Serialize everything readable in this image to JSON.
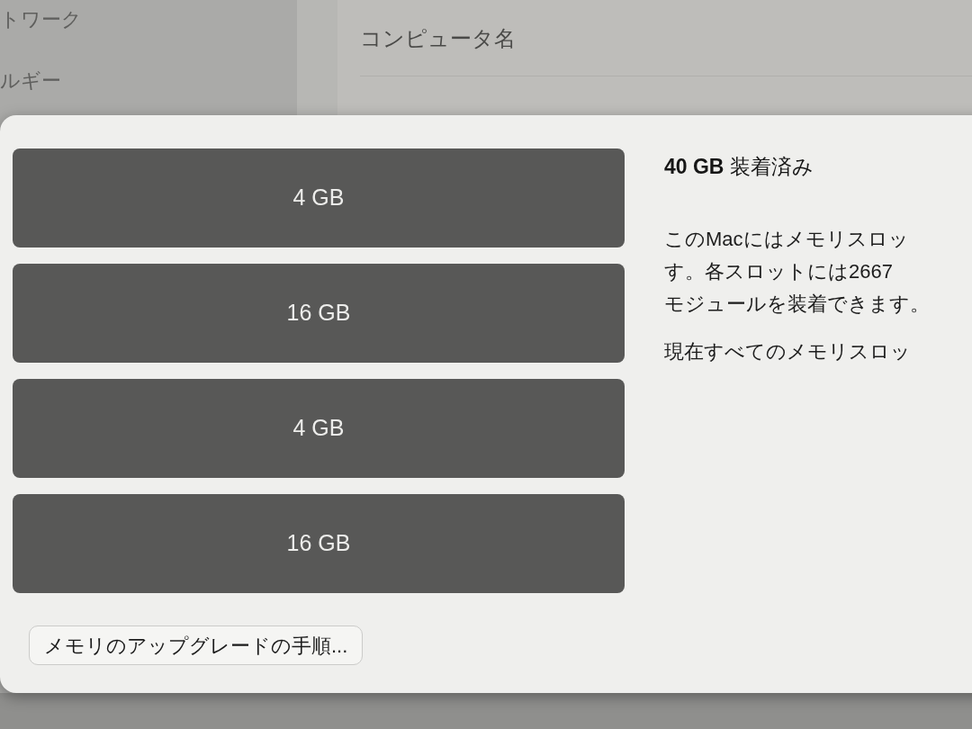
{
  "background": {
    "sidebar": {
      "items": [
        {
          "label": "トワーク"
        },
        {
          "label": "ルギー"
        }
      ]
    },
    "rows": [
      {
        "label": "コンピュータ名"
      }
    ]
  },
  "sheet": {
    "slots": [
      {
        "label": "4 GB"
      },
      {
        "label": "16 GB"
      },
      {
        "label": "4 GB"
      },
      {
        "label": "16 GB"
      }
    ],
    "button": "メモリのアップグレードの手順...",
    "heading": "**40 GB** 装着済み",
    "description": [
      "このMacにはメモリスロッ",
      "す。各スロットには2667",
      "モジュールを装着できます。"
    ],
    "note": "現在すべてのメモリスロッ"
  }
}
